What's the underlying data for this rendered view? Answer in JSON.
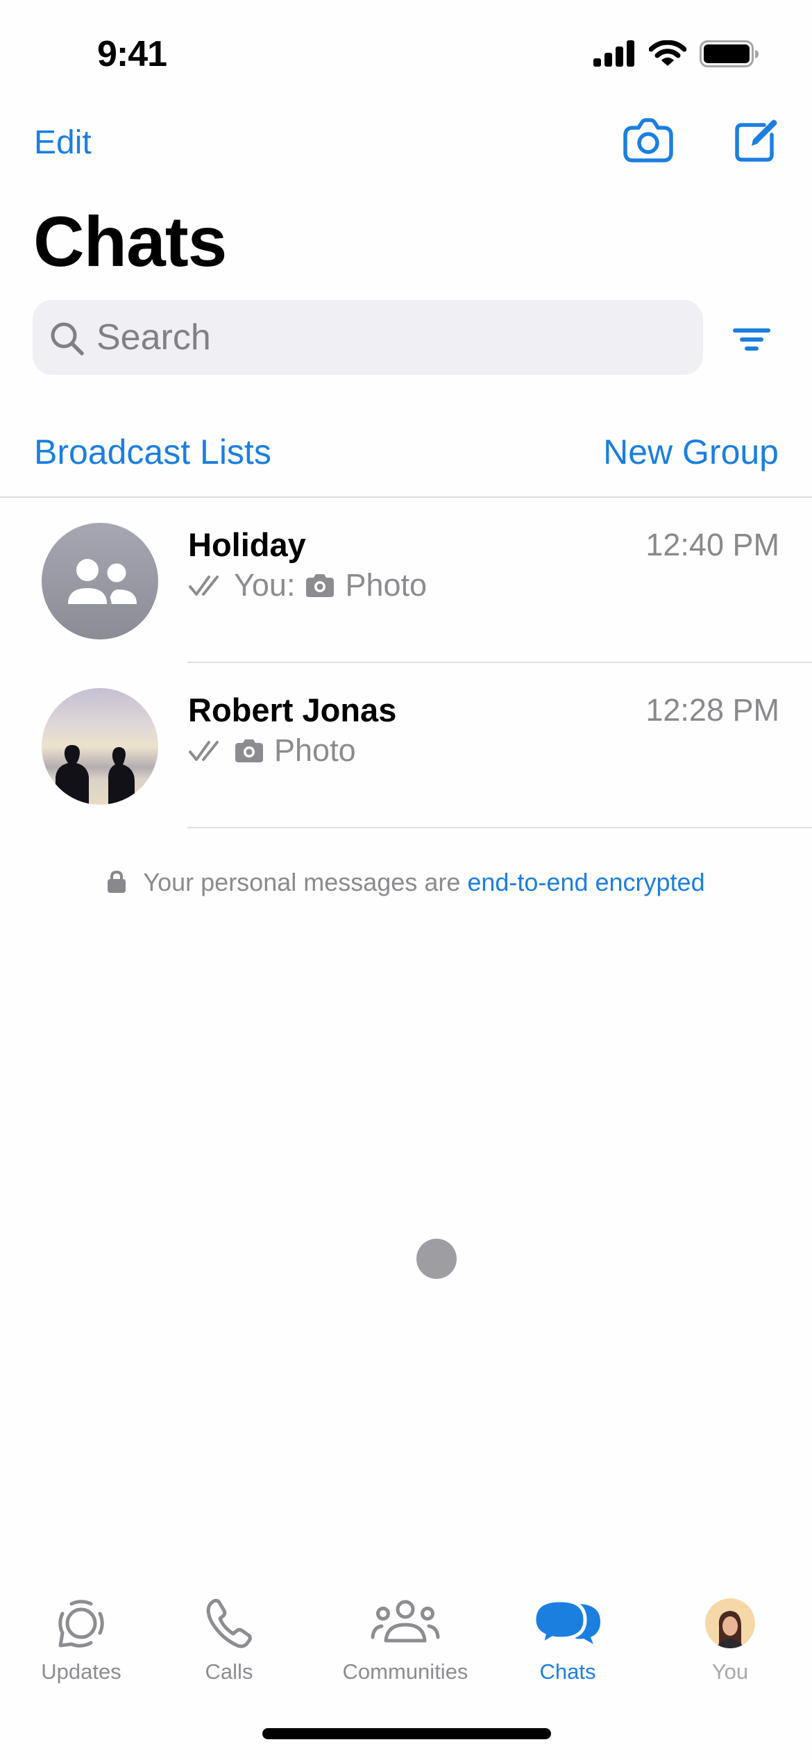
{
  "status_bar": {
    "time": "9:41",
    "icons": [
      "cellular-signal-icon",
      "wifi-icon",
      "battery-icon"
    ]
  },
  "nav": {
    "edit_label": "Edit",
    "camera_icon": "camera-icon",
    "compose_icon": "compose-icon"
  },
  "header": {
    "title": "Chats"
  },
  "search": {
    "placeholder": "Search",
    "value": "",
    "filter_icon": "filter-icon"
  },
  "actions": {
    "broadcast_lists": "Broadcast Lists",
    "new_group": "New Group"
  },
  "chats": [
    {
      "name": "Holiday",
      "time": "12:40 PM",
      "status": "read",
      "sender": "You:",
      "preview": "Photo",
      "avatar": "group-avatar-icon"
    },
    {
      "name": "Robert Jonas",
      "time": "12:28 PM",
      "status": "read",
      "sender": "",
      "preview": "Photo",
      "avatar": "photo-two-people-silhouette"
    }
  ],
  "encryption_notice": {
    "text": "Your personal messages are ",
    "link": "end-to-end encrypted"
  },
  "tab_bar": {
    "active": "Chats",
    "tabs": [
      {
        "label": "Updates",
        "icon": "updates-icon"
      },
      {
        "label": "Calls",
        "icon": "phone-icon"
      },
      {
        "label": "Communities",
        "icon": "communities-icon"
      },
      {
        "label": "Chats",
        "icon": "chats-icon"
      },
      {
        "label": "You",
        "icon": "profile-avatar"
      }
    ]
  },
  "colors": {
    "accent": "#1b7fdf",
    "secondary_text": "#8a8a8f",
    "search_bg": "#f0eff4",
    "separator": "#dfdfe1"
  }
}
